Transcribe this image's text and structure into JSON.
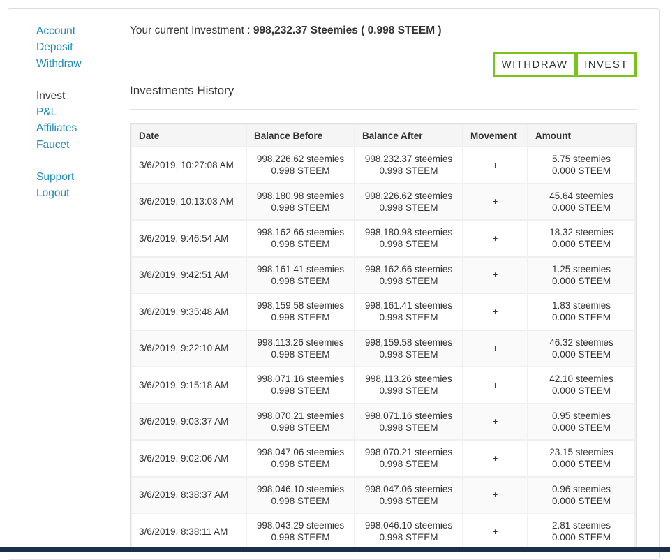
{
  "sidebar": {
    "groups": [
      [
        {
          "label": "Account",
          "active": false
        },
        {
          "label": "Deposit",
          "active": false
        },
        {
          "label": "Withdraw",
          "active": false
        }
      ],
      [
        {
          "label": "Invest",
          "active": true
        },
        {
          "label": "P&L",
          "active": false
        },
        {
          "label": "Affiliates",
          "active": false
        },
        {
          "label": "Faucet",
          "active": false
        }
      ],
      [
        {
          "label": "Support",
          "active": false
        },
        {
          "label": "Logout",
          "active": false
        }
      ]
    ]
  },
  "investment": {
    "prefix": "Your current Investment : ",
    "value": "998,232.37 Steemies ( 0.998 STEEM )"
  },
  "buttons": {
    "withdraw": "WITHDRAW",
    "invest": "INVEST"
  },
  "history": {
    "title": "Investments History",
    "columns": [
      "Date",
      "Balance Before",
      "Balance After",
      "Movement",
      "Amount"
    ],
    "rows": [
      {
        "date": "3/6/2019, 10:27:08 AM",
        "before": [
          "998,226.62 steemies",
          "0.998 STEEM"
        ],
        "after": [
          "998,232.37 steemies",
          "0.998 STEEM"
        ],
        "movement": "+",
        "amount": [
          "5.75 steemies",
          "0.000 STEEM"
        ]
      },
      {
        "date": "3/6/2019, 10:13:03 AM",
        "before": [
          "998,180.98 steemies",
          "0.998 STEEM"
        ],
        "after": [
          "998,226.62 steemies",
          "0.998 STEEM"
        ],
        "movement": "+",
        "amount": [
          "45.64 steemies",
          "0.000 STEEM"
        ]
      },
      {
        "date": "3/6/2019, 9:46:54 AM",
        "before": [
          "998,162.66 steemies",
          "0.998 STEEM"
        ],
        "after": [
          "998,180.98 steemies",
          "0.998 STEEM"
        ],
        "movement": "+",
        "amount": [
          "18.32 steemies",
          "0.000 STEEM"
        ]
      },
      {
        "date": "3/6/2019, 9:42:51 AM",
        "before": [
          "998,161.41 steemies",
          "0.998 STEEM"
        ],
        "after": [
          "998,162.66 steemies",
          "0.998 STEEM"
        ],
        "movement": "+",
        "amount": [
          "1.25 steemies",
          "0.000 STEEM"
        ]
      },
      {
        "date": "3/6/2019, 9:35:48 AM",
        "before": [
          "998,159.58 steemies",
          "0.998 STEEM"
        ],
        "after": [
          "998,161.41 steemies",
          "0.998 STEEM"
        ],
        "movement": "+",
        "amount": [
          "1.83 steemies",
          "0.000 STEEM"
        ]
      },
      {
        "date": "3/6/2019, 9:22:10 AM",
        "before": [
          "998,113.26 steemies",
          "0.998 STEEM"
        ],
        "after": [
          "998,159.58 steemies",
          "0.998 STEEM"
        ],
        "movement": "+",
        "amount": [
          "46.32 steemies",
          "0.000 STEEM"
        ]
      },
      {
        "date": "3/6/2019, 9:15:18 AM",
        "before": [
          "998,071.16 steemies",
          "0.998 STEEM"
        ],
        "after": [
          "998,113.26 steemies",
          "0.998 STEEM"
        ],
        "movement": "+",
        "amount": [
          "42.10 steemies",
          "0.000 STEEM"
        ]
      },
      {
        "date": "3/6/2019, 9:03:37 AM",
        "before": [
          "998,070.21 steemies",
          "0.998 STEEM"
        ],
        "after": [
          "998,071.16 steemies",
          "0.998 STEEM"
        ],
        "movement": "+",
        "amount": [
          "0.95 steemies",
          "0.000 STEEM"
        ]
      },
      {
        "date": "3/6/2019, 9:02:06 AM",
        "before": [
          "998,047.06 steemies",
          "0.998 STEEM"
        ],
        "after": [
          "998,070.21 steemies",
          "0.998 STEEM"
        ],
        "movement": "+",
        "amount": [
          "23.15 steemies",
          "0.000 STEEM"
        ]
      },
      {
        "date": "3/6/2019, 8:38:37 AM",
        "before": [
          "998,046.10 steemies",
          "0.998 STEEM"
        ],
        "after": [
          "998,047.06 steemies",
          "0.998 STEEM"
        ],
        "movement": "+",
        "amount": [
          "0.96 steemies",
          "0.000 STEEM"
        ]
      },
      {
        "date": "3/6/2019, 8:38:11 AM",
        "before": [
          "998,043.29 steemies",
          "0.998 STEEM"
        ],
        "after": [
          "998,046.10 steemies",
          "0.998 STEEM"
        ],
        "movement": "+",
        "amount": [
          "2.81 steemies",
          "0.000 STEEM"
        ]
      }
    ]
  },
  "colors": {
    "link": "#1f8bb8",
    "button_border": "#7cc21c",
    "footer_bar": "#1b2f4a"
  }
}
